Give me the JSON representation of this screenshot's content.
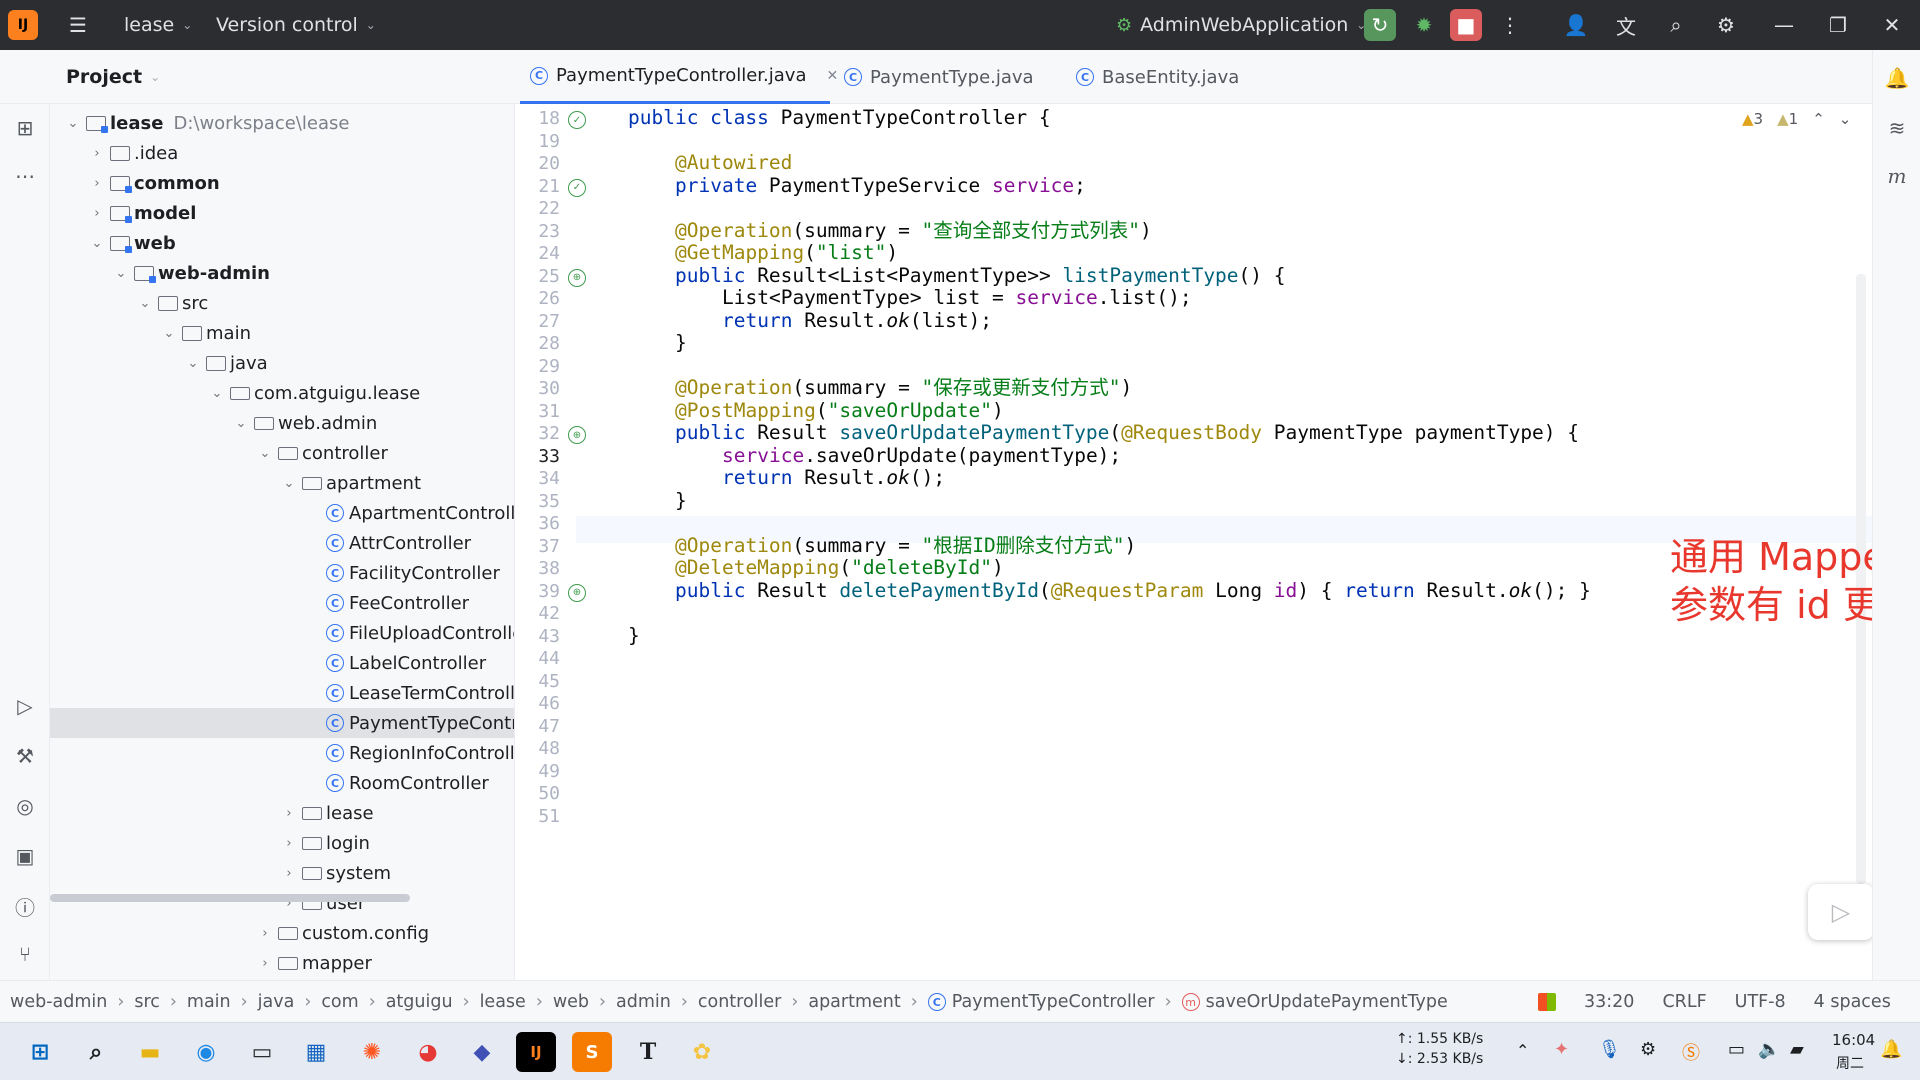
{
  "titlebar": {
    "project_name": "lease",
    "vcs_label": "Version control",
    "run_config": "AdminWebApplication"
  },
  "tabs": [
    {
      "label": "PaymentTypeController.java",
      "active": true
    },
    {
      "label": "PaymentType.java",
      "active": false
    },
    {
      "label": "BaseEntity.java",
      "active": false
    }
  ],
  "project_panel": {
    "title": "Project",
    "root_name": "lease",
    "root_path": "D:\\workspace\\lease",
    "items": [
      {
        "label": ".idea",
        "kind": "folder"
      },
      {
        "label": "common",
        "kind": "module"
      },
      {
        "label": "model",
        "kind": "module"
      },
      {
        "label": "web",
        "kind": "module"
      },
      {
        "label": "web-admin",
        "kind": "module"
      },
      {
        "label": "src",
        "kind": "folder"
      },
      {
        "label": "main",
        "kind": "folder"
      },
      {
        "label": "java",
        "kind": "folder"
      },
      {
        "label": "com.atguigu.lease",
        "kind": "package"
      },
      {
        "label": "web.admin",
        "kind": "package"
      },
      {
        "label": "controller",
        "kind": "package"
      },
      {
        "label": "apartment",
        "kind": "package"
      },
      {
        "label": "ApartmentControlle",
        "kind": "class"
      },
      {
        "label": "AttrController",
        "kind": "class"
      },
      {
        "label": "FacilityController",
        "kind": "class"
      },
      {
        "label": "FeeController",
        "kind": "class"
      },
      {
        "label": "FileUploadControlle",
        "kind": "class"
      },
      {
        "label": "LabelController",
        "kind": "class"
      },
      {
        "label": "LeaseTermControlle",
        "kind": "class"
      },
      {
        "label": "PaymentTypeContr",
        "kind": "class"
      },
      {
        "label": "RegionInfoControlle",
        "kind": "class"
      },
      {
        "label": "RoomController",
        "kind": "class"
      },
      {
        "label": "lease",
        "kind": "package"
      },
      {
        "label": "login",
        "kind": "package"
      },
      {
        "label": "system",
        "kind": "package"
      },
      {
        "label": "user",
        "kind": "package"
      },
      {
        "label": "custom.config",
        "kind": "package"
      },
      {
        "label": "mapper",
        "kind": "package"
      }
    ]
  },
  "editor": {
    "inspections": {
      "warnings": "3",
      "weak_warnings": "1"
    },
    "line_numbers": [
      "18",
      "19",
      "20",
      "21",
      "22",
      "23",
      "24",
      "25",
      "26",
      "27",
      "28",
      "29",
      "30",
      "31",
      "32",
      "33",
      "34",
      "35",
      "36",
      "37",
      "38",
      "39",
      "42",
      "43",
      "44",
      "45",
      "46",
      "47",
      "48",
      "49",
      "50",
      "51"
    ],
    "current_line": "33",
    "code": {
      "l18_a": "public class ",
      "l18_b": "PaymentTypeController {",
      "l20": "@Autowired",
      "l21_a": "private ",
      "l21_b": "PaymentTypeService ",
      "l21_c": "service",
      "l21_d": ";",
      "l23_a": "@Operation",
      "l23_b": "(summary = ",
      "l23_c": "\"查询全部支付方式列表\"",
      "l23_d": ")",
      "l24_a": "@GetMapping",
      "l24_b": "(",
      "l24_c": "\"list\"",
      "l24_d": ")",
      "l25_a": "public ",
      "l25_b": "Result<List<PaymentType>> ",
      "l25_c": "listPaymentType",
      "l25_d": "() {",
      "l26_a": "List<PaymentType> list = ",
      "l26_b": "service",
      "l26_c": ".list();",
      "l27_a": "return ",
      "l27_b": "Result.",
      "l27_c": "ok",
      "l27_d": "(list);",
      "l28": "}",
      "l30_a": "@Operation",
      "l30_b": "(summary = ",
      "l30_c": "\"保存或更新支付方式\"",
      "l30_d": ")",
      "l31_a": "@PostMapping",
      "l31_b": "(",
      "l31_c": "\"saveOrUpdate\"",
      "l31_d": ")",
      "l32_a": "public ",
      "l32_b": "Result ",
      "l32_c": "saveOrUpdatePaymentType",
      "l32_d": "(",
      "l32_e": "@RequestBody ",
      "l32_f": "PaymentType paymentType) {",
      "l33_a": "service",
      "l33_b": ".saveOrUpdate(paymentType);",
      "l34_a": "return ",
      "l34_b": "Result.",
      "l34_c": "ok",
      "l34_d": "();",
      "l35": "}",
      "l37_a": "@Operation",
      "l37_b": "(summary = ",
      "l37_c": "\"根据ID删除支付方式\"",
      "l37_d": ")",
      "l38_a": "@DeleteMapping",
      "l38_b": "(",
      "l38_c": "\"deleteById\"",
      "l38_d": ")",
      "l39_a": "public ",
      "l39_b": "Result ",
      "l39_c": "deletePaymentById",
      "l39_d": "(",
      "l39_e": "@RequestParam ",
      "l39_f": "Long ",
      "l39_g": "id",
      "l39_h": ") { ",
      "l39_i": "return ",
      "l39_j": "Result.",
      "l39_k": "ok",
      "l39_l": "(); }",
      "l43": "}"
    }
  },
  "overlay": {
    "line1": "通用 Mapper 生成的保存或更新方法，",
    "line2": "参数有 id 更新，没 id 保存。"
  },
  "statusbar": {
    "breadcrumbs": [
      "web-admin",
      "src",
      "main",
      "java",
      "com",
      "atguigu",
      "lease",
      "web",
      "admin",
      "controller",
      "apartment",
      "PaymentTypeController",
      "saveOrUpdatePaymentType"
    ],
    "position": "33:20",
    "line_ending": "CRLF",
    "encoding": "UTF-8",
    "indent": "4 spaces"
  },
  "taskbar": {
    "net_up": "↑: 1.55 KB/s",
    "net_down": "↓: 2.53 KB/s",
    "time": "16:04",
    "weekday": "周二"
  },
  "colors": {
    "titlebar_bg": "#2b2d30",
    "accent_blue": "#3574f0",
    "keyword": "#0033b3",
    "annotation": "#9e880d",
    "string": "#067d17",
    "field": "#871094",
    "overlay_red": "#e8372c"
  }
}
